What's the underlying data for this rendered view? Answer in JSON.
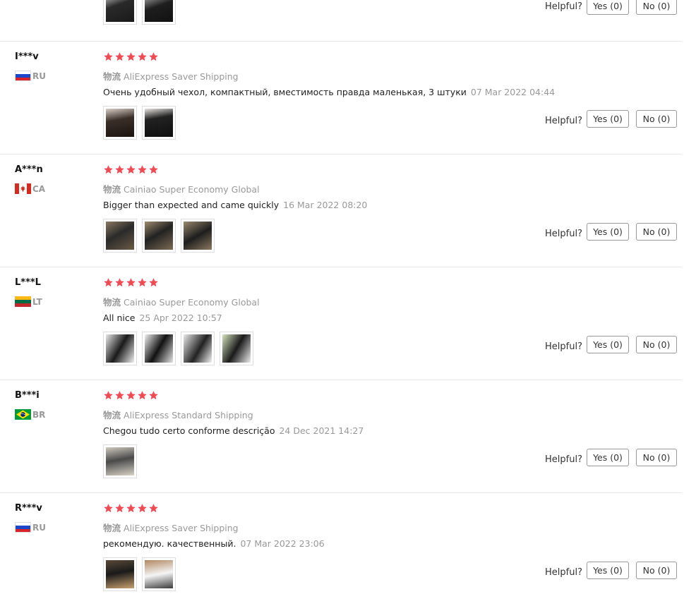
{
  "helpful_label": "Helpful?",
  "star_color": "#f04a55",
  "top_partial": {
    "yes_label": "Yes (0)",
    "no_label": "No (0)",
    "thumbnails": 2
  },
  "reviews": [
    {
      "user": "I***v",
      "country": "RU",
      "flag_icon": "russia-flag-icon",
      "stars": 5,
      "shipping_label": "物流",
      "shipping": "AliExpress Saver Shipping",
      "text": "Очень удобный чехол, компактный, вместимость правда маленькая, 3 штуки",
      "date": "07 Mar 2022 04:44",
      "thumbnails": 2,
      "yes_label": "Yes (0)",
      "no_label": "No (0)"
    },
    {
      "user": "A***n",
      "country": "CA",
      "flag_icon": "canada-flag-icon",
      "stars": 5,
      "shipping_label": "物流",
      "shipping": "Cainiao Super Economy Global",
      "text": "Bigger than expected and came quickly",
      "date": "16 Mar 2022 08:20",
      "thumbnails": 3,
      "yes_label": "Yes (0)",
      "no_label": "No (0)"
    },
    {
      "user": "L***L",
      "country": "LT",
      "flag_icon": "lithuania-flag-icon",
      "stars": 5,
      "shipping_label": "物流",
      "shipping": "Cainiao Super Economy Global",
      "text": "All nice",
      "date": "25 Apr 2022 10:57",
      "thumbnails": 4,
      "yes_label": "Yes (0)",
      "no_label": "No (0)"
    },
    {
      "user": "B***i",
      "country": "BR",
      "flag_icon": "brazil-flag-icon",
      "stars": 5,
      "shipping_label": "物流",
      "shipping": "AliExpress Standard Shipping",
      "text": "Chegou tudo certo conforme descrição",
      "date": "24 Dec 2021 14:27",
      "thumbnails": 1,
      "yes_label": "Yes (0)",
      "no_label": "No (0)"
    },
    {
      "user": "R***v",
      "country": "RU",
      "flag_icon": "russia-flag-icon",
      "stars": 5,
      "shipping_label": "物流",
      "shipping": "AliExpress Saver Shipping",
      "text": "рекомендую. качественный.",
      "date": "07 Mar 2022 23:06",
      "thumbnails": 2,
      "yes_label": "Yes (0)",
      "no_label": "No (0)"
    }
  ]
}
